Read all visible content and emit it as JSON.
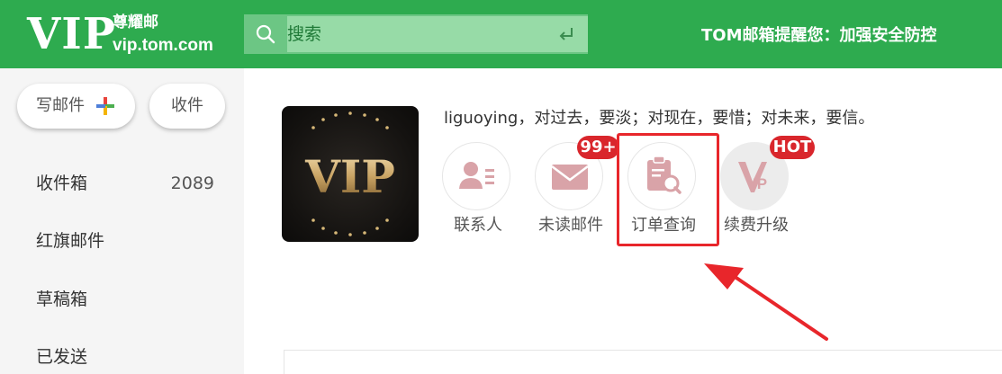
{
  "header": {
    "logo_text": "VIP",
    "brand_name": "尊耀邮",
    "domain": "vip.tom.com",
    "search_placeholder": "搜索",
    "notice": "TOM邮箱提醒您：加强安全防控",
    "bg_color": "#2eab4f"
  },
  "sidebar": {
    "compose_label": "写邮件",
    "receive_label": "收件",
    "folders": [
      {
        "label": "收件箱",
        "count": "2089"
      },
      {
        "label": "红旗邮件",
        "count": ""
      },
      {
        "label": "草稿箱",
        "count": ""
      },
      {
        "label": "已发送",
        "count": ""
      }
    ]
  },
  "profile": {
    "avatar_text": "VIP",
    "motto": "liguoying，对过去，要淡；对现在，要惜；对未来，要信。"
  },
  "quick_actions": [
    {
      "label": "联系人",
      "icon": "contacts-icon",
      "badge": ""
    },
    {
      "label": "未读邮件",
      "icon": "mail-icon",
      "badge": "99+"
    },
    {
      "label": "订单查询",
      "icon": "order-search-icon",
      "badge": ""
    },
    {
      "label": "续费升级",
      "icon": "vip-upgrade-icon",
      "badge": "HOT"
    }
  ],
  "colors": {
    "accent": "#2eab4f",
    "icon_pink": "#d9a3a8",
    "badge_red": "#d9262c",
    "annotation_red": "#e8262b"
  }
}
